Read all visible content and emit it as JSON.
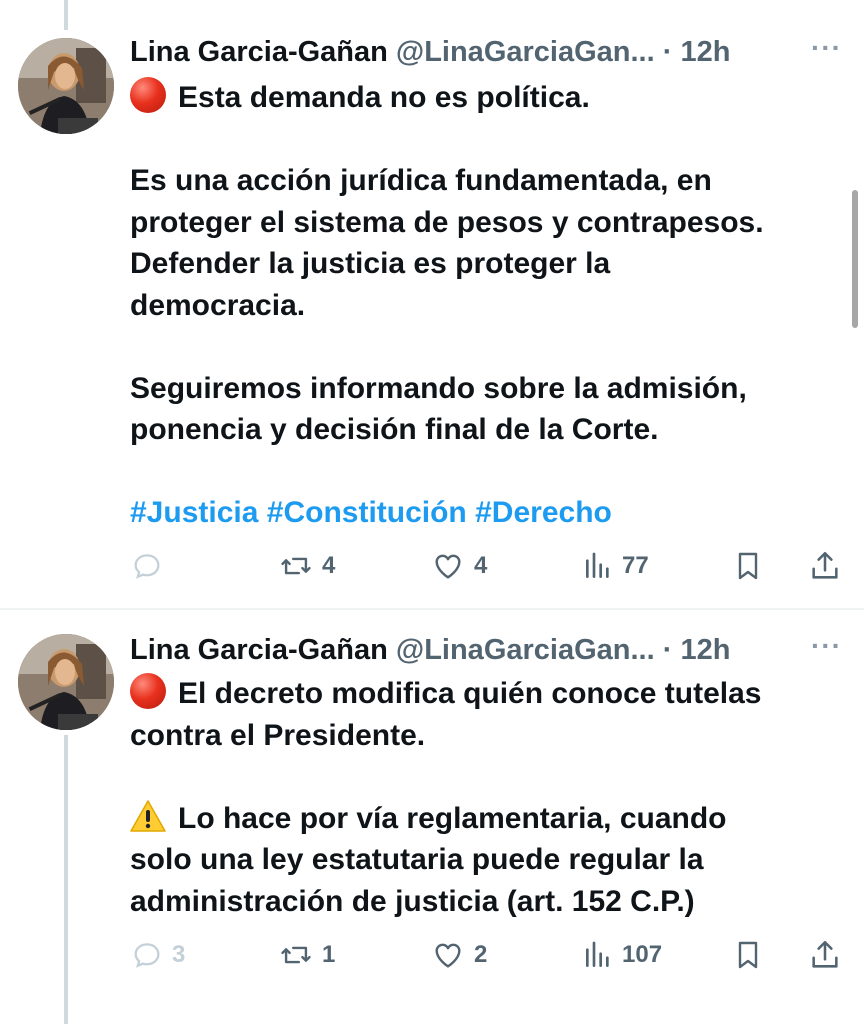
{
  "tweets": [
    {
      "author_name": "Lina Garcia-Gañan",
      "handle": "@LinaGarciaGan...",
      "time": "12h",
      "more_label": "···",
      "lines": [
        "Esta demanda no es política.",
        "Es una acción jurídica fundamentada, en",
        "proteger el sistema de pesos y contrapesos.",
        "Defender la justicia es proteger la",
        "democracia.",
        "Seguiremos informando sobre la admisión,",
        "ponencia y decisión final de la Corte."
      ],
      "hashtags": [
        "#Justicia",
        "#Constitución",
        "#Derecho"
      ],
      "stats": {
        "replies": "",
        "reposts": "4",
        "likes": "4",
        "views": "77"
      }
    },
    {
      "author_name": "Lina Garcia-Gañan",
      "handle": "@LinaGarciaGan...",
      "time": "12h",
      "more_label": "···",
      "lines": [
        "El decreto modifica quién conoce tutelas",
        "contra el Presidente.",
        "Lo hace por vía reglamentaria, cuando",
        "solo una ley estatutaria puede regular la",
        "administración de justicia (art. 152 C.P.)"
      ],
      "hashtags": [],
      "stats": {
        "replies": "3",
        "reposts": "1",
        "likes": "2",
        "views": "107"
      }
    }
  ],
  "icons": {
    "red_circle": "red-circle-emoji-icon",
    "warning": "warning-emoji-icon",
    "reply": "reply-icon",
    "repost": "repost-icon",
    "like": "heart-icon",
    "views": "views-chart-icon",
    "bookmark": "bookmark-icon",
    "share": "share-icon"
  },
  "colors": {
    "hashtag": "#1d9bf0",
    "muted": "#536471",
    "text": "#0f1419"
  }
}
